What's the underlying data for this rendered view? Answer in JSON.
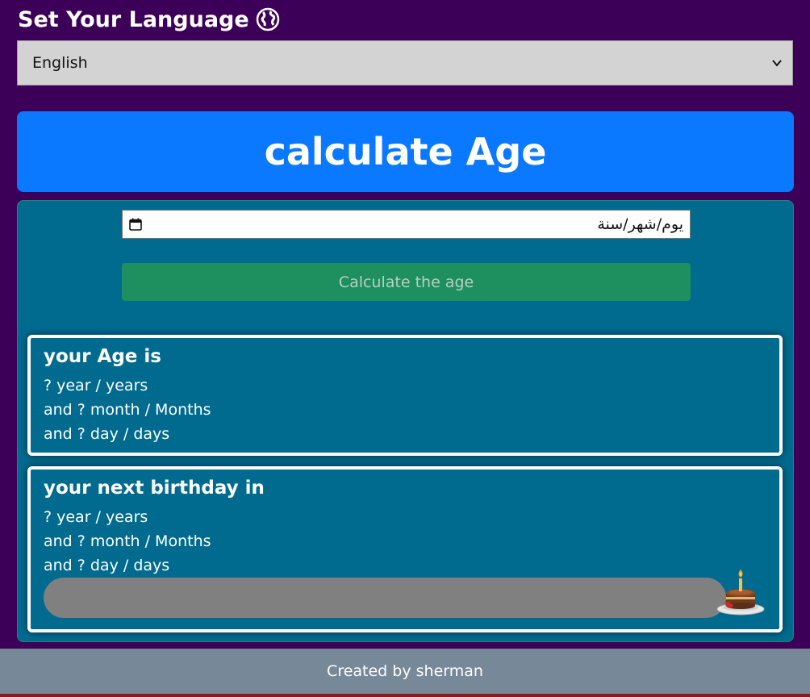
{
  "language": {
    "heading": "Set Your Language",
    "heading_icon": "globe-icon",
    "selected": "English",
    "select_icon": "chevron-down-icon"
  },
  "banner": {
    "title": "calculate Age"
  },
  "form": {
    "date_value": "يوم/شهر/سنة",
    "date_icon": "calendar-icon",
    "button_label": "Calculate the age"
  },
  "age_result": {
    "title": "your Age is",
    "line_years": "? year / years",
    "line_months": "and ? month / Months",
    "line_days": "and ? day / days"
  },
  "birthday_result": {
    "title": "your next birthday in",
    "line_years": "? year / years",
    "line_months": "and ? month / Months",
    "line_days": "and ? day / days",
    "progress": 0,
    "progress_icon": "cake-icon"
  },
  "footer": {
    "text": "Created by sherman"
  },
  "colors": {
    "background": "#3d0059",
    "banner": "#0a78ff",
    "card": "#006b8f",
    "button": "#1e8f5e",
    "footer": "#778899"
  }
}
